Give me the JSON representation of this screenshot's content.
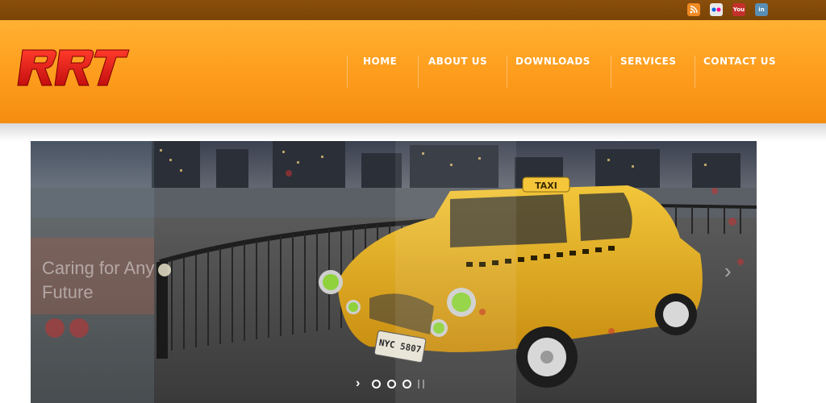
{
  "topbar": {
    "social": [
      {
        "name": "rss-icon",
        "glyph": ""
      },
      {
        "name": "flickr-icon",
        "glyph": "••"
      },
      {
        "name": "youtube-icon",
        "glyph": "You"
      },
      {
        "name": "linkedin-icon",
        "glyph": "in"
      }
    ]
  },
  "header": {
    "logo_text": "RRT",
    "logo_color": "#e41d1d",
    "nav": [
      {
        "label": "HOME"
      },
      {
        "label": "ABOUT US"
      },
      {
        "label": "DOWNLOADS"
      },
      {
        "label": "SERVICES"
      },
      {
        "label": "CONTACT US"
      }
    ]
  },
  "slider": {
    "caption": "Caring for Any Future",
    "taxi_sign": "TAXI",
    "plate": "NYC 5807",
    "slide_count": 3,
    "active_slide": 1
  },
  "colors": {
    "topbar": "#7a4406",
    "header_orange": "#ff9f1f",
    "taxi_yellow": "#e8b21e"
  }
}
